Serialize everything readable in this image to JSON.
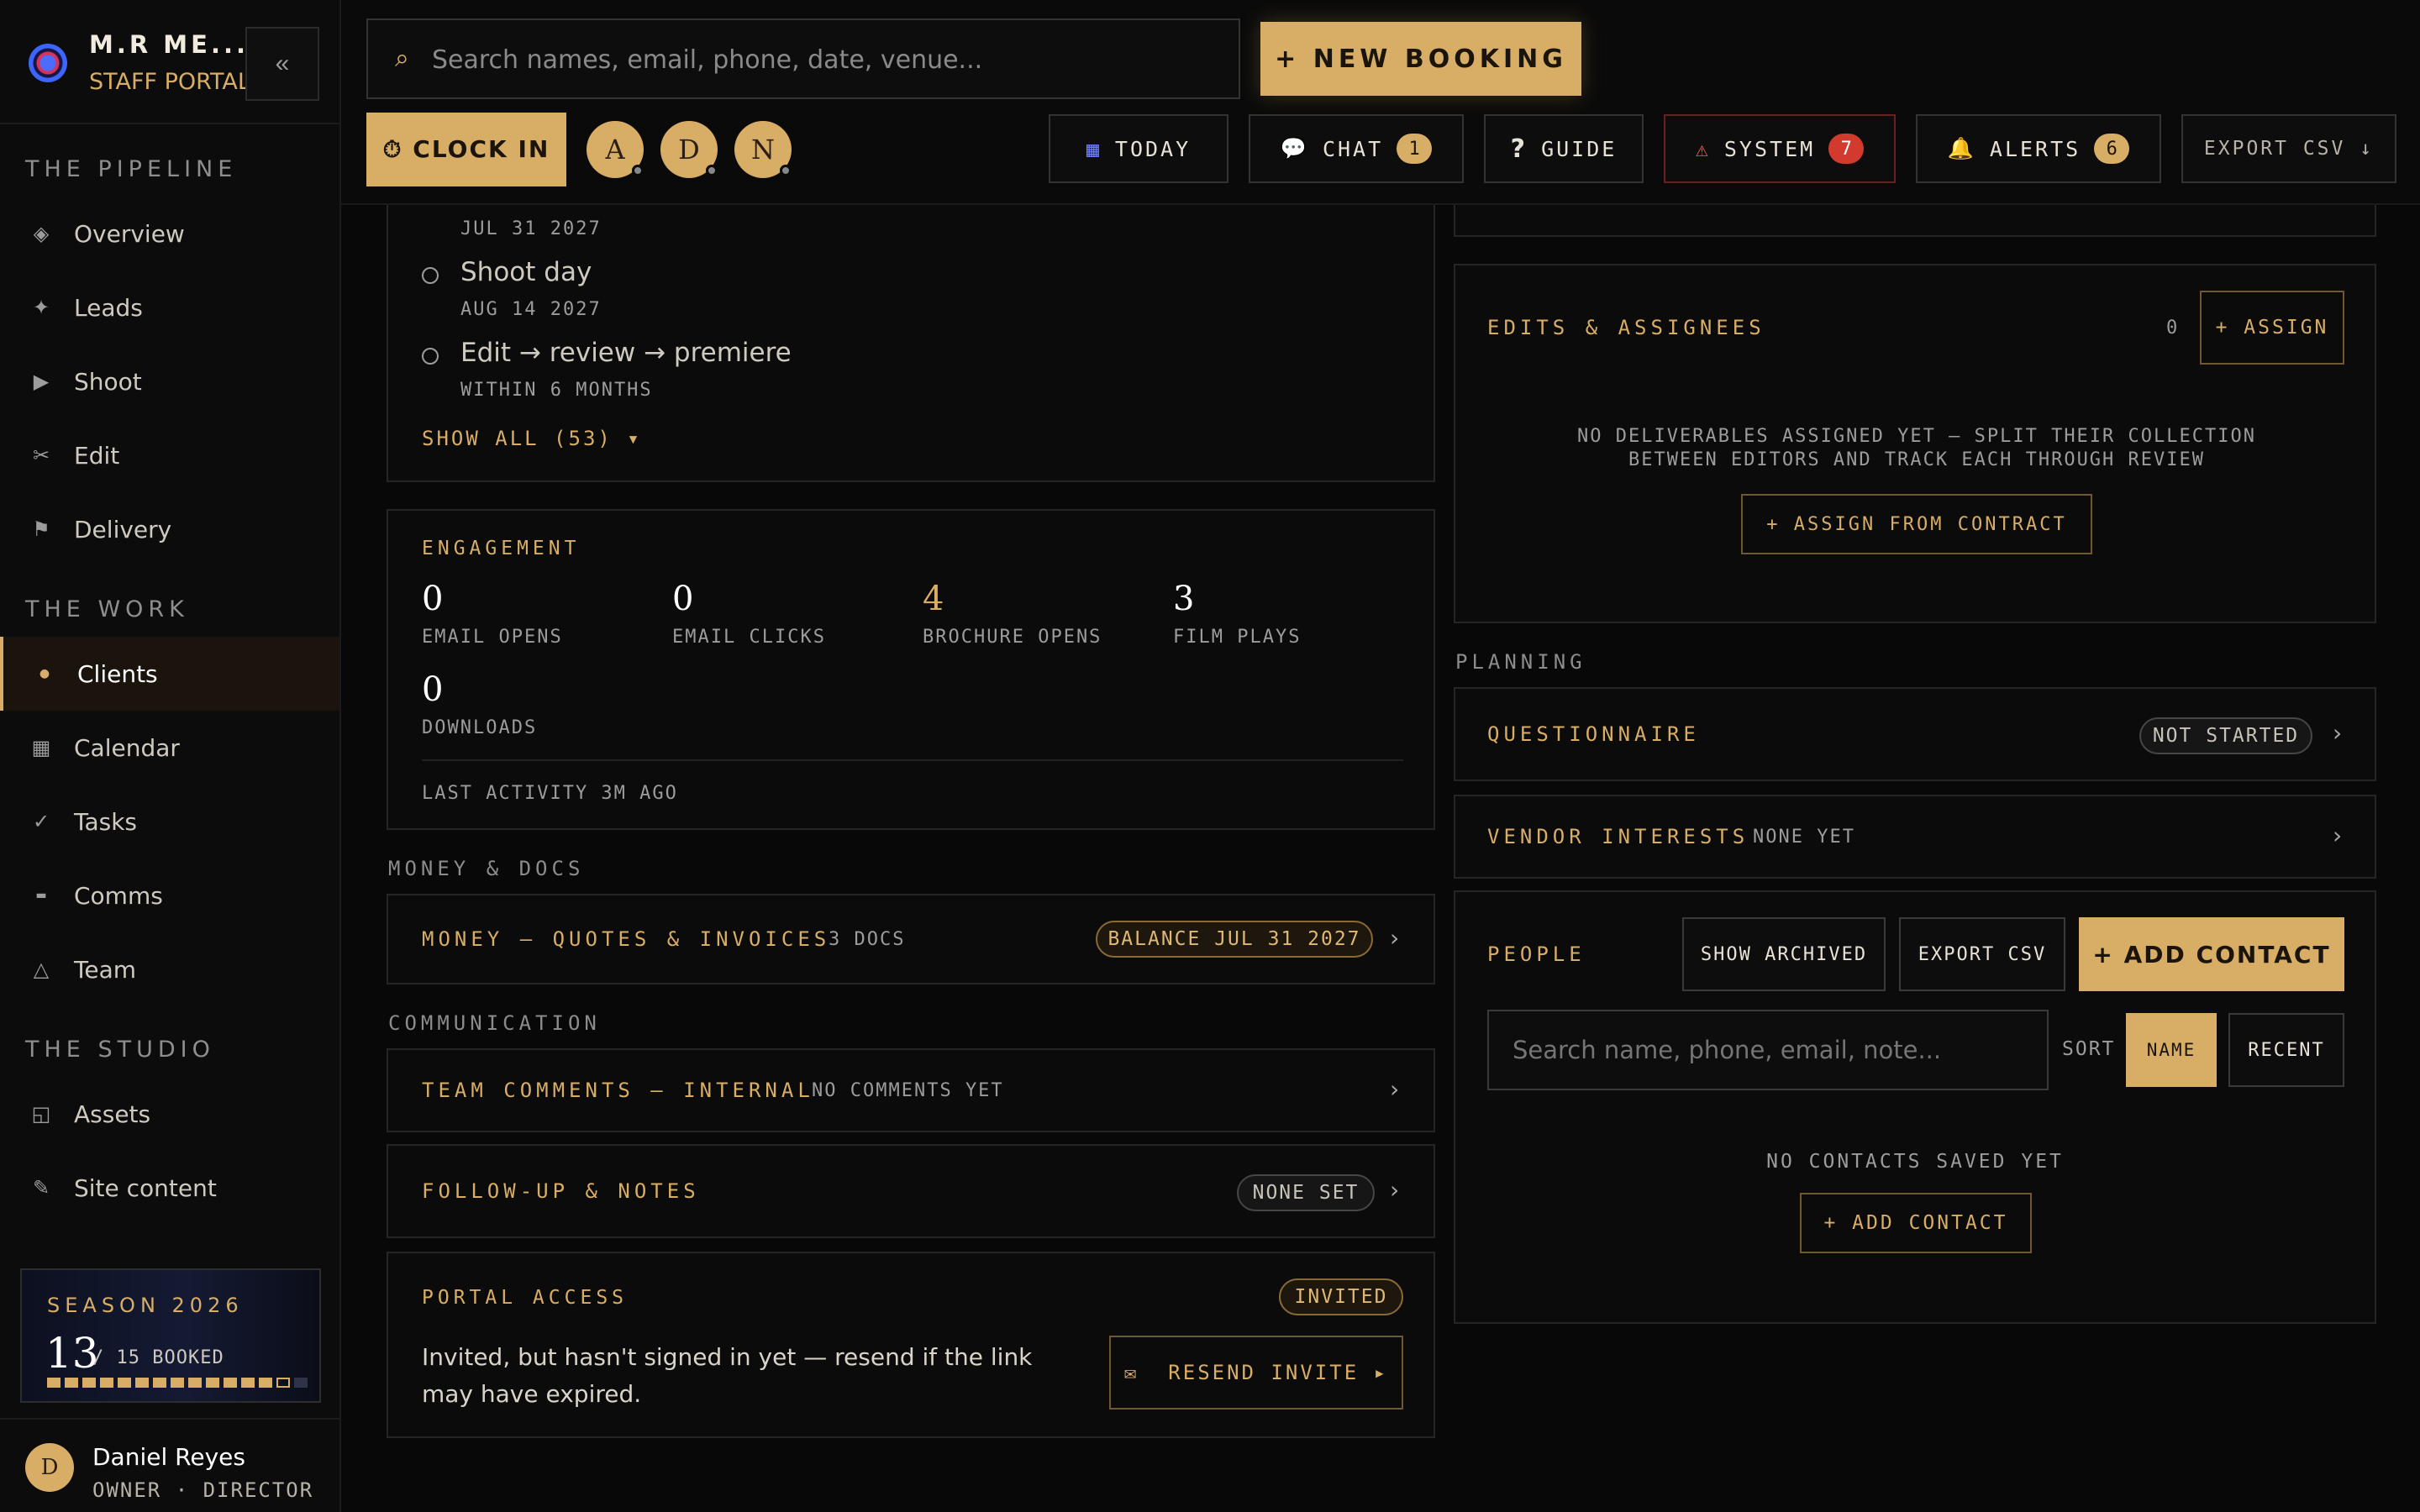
{
  "brand": {
    "name": "M.R ME...",
    "subtitle": "STAFF PORTAL",
    "collapse_glyph": "«"
  },
  "sidebar": {
    "sections": [
      {
        "title": "THE PIPELINE",
        "items": [
          {
            "label": "Overview",
            "icon": "diamond-icon",
            "glyph": "◈"
          },
          {
            "label": "Leads",
            "icon": "sparkle-icon",
            "glyph": "✦"
          },
          {
            "label": "Shoot",
            "icon": "play-icon",
            "glyph": "▶"
          },
          {
            "label": "Edit",
            "icon": "scissors-icon",
            "glyph": "✂"
          },
          {
            "label": "Delivery",
            "icon": "flag-icon",
            "glyph": "⚑"
          }
        ]
      },
      {
        "title": "THE WORK",
        "items": [
          {
            "label": "Clients",
            "icon": "dot-icon",
            "glyph": "●",
            "active": true
          },
          {
            "label": "Calendar",
            "icon": "calendar-grid-icon",
            "glyph": "▦"
          },
          {
            "label": "Tasks",
            "icon": "check-icon",
            "glyph": "✓"
          },
          {
            "label": "Comms",
            "icon": "dash-icon",
            "glyph": "▬"
          },
          {
            "label": "Team",
            "icon": "triangle-icon",
            "glyph": "△"
          }
        ]
      },
      {
        "title": "THE STUDIO",
        "items": [
          {
            "label": "Assets",
            "icon": "assets-icon",
            "glyph": "◱"
          },
          {
            "label": "Site content",
            "icon": "pencil-icon",
            "glyph": "✎"
          }
        ]
      }
    ],
    "season": {
      "title": "SEASON 2026",
      "booked": "13",
      "of_text": "/ 15 BOOKED",
      "booked_count": 13,
      "total": 15
    },
    "user": {
      "initial": "D",
      "name": "Daniel Reyes",
      "role": "OWNER · DIRECTOR"
    }
  },
  "topbar": {
    "search_placeholder": "Search names, email, phone, date, venue...",
    "new_booking": "+ NEW BOOKING",
    "clock_in": "CLOCK IN",
    "presence": [
      "A",
      "D",
      "N"
    ],
    "buttons": {
      "today": "TODAY",
      "chat": "CHAT",
      "chat_count": "1",
      "guide": "GUIDE",
      "system": "SYSTEM",
      "system_count": "7",
      "alerts": "ALERTS",
      "alerts_count": "6",
      "export": "EXPORT CSV ↓"
    }
  },
  "milestones": {
    "top_date": "JUL 31 2027",
    "items": [
      {
        "title": "Shoot day",
        "date": "AUG 14 2027"
      },
      {
        "title": "Edit → review → premiere",
        "date": "WITHIN 6 MONTHS"
      }
    ],
    "show_all": "SHOW ALL (53) ▾"
  },
  "engagement": {
    "title": "ENGAGEMENT",
    "stats": [
      {
        "value": "0",
        "label": "EMAIL OPENS"
      },
      {
        "value": "0",
        "label": "EMAIL CLICKS"
      },
      {
        "value": "4",
        "label": "BROCHURE OPENS"
      },
      {
        "value": "3",
        "label": "FILM PLAYS"
      },
      {
        "value": "0",
        "label": "DOWNLOADS"
      }
    ],
    "last_activity": "LAST ACTIVITY 3M AGO"
  },
  "money_docs": {
    "section": "MONEY & DOCS",
    "title": "MONEY — QUOTES & INVOICES",
    "docs": "3 DOCS",
    "badge": "BALANCE JUL 31 2027"
  },
  "communication": {
    "section": "COMMUNICATION",
    "comments_title": "TEAM COMMENTS — INTERNAL",
    "comments_status": "NO COMMENTS YET",
    "followup_title": "FOLLOW-UP & NOTES",
    "followup_badge": "NONE SET"
  },
  "portal": {
    "title": "PORTAL ACCESS",
    "badge": "INVITED",
    "text": "Invited, but hasn't signed in yet — resend if the link may have expired.",
    "resend": "RESEND INVITE ▸"
  },
  "edits": {
    "title": "EDITS & ASSIGNEES",
    "count": "0",
    "assign": "+ ASSIGN",
    "empty": "NO DELIVERABLES ASSIGNED YET — SPLIT THEIR COLLECTION BETWEEN EDITORS AND TRACK EACH THROUGH REVIEW",
    "assign_from_contract": "+ ASSIGN FROM CONTRACT"
  },
  "planning": {
    "section": "PLANNING",
    "questionnaire": "QUESTIONNAIRE",
    "questionnaire_badge": "NOT STARTED",
    "vendor": "VENDOR INTERESTS",
    "vendor_status": "NONE YET"
  },
  "people": {
    "title": "PEOPLE",
    "show_archived": "SHOW ARCHIVED",
    "export": "EXPORT CSV",
    "add_contact": "+ ADD CONTACT",
    "search_placeholder": "Search name, phone, email, note...",
    "sort_label": "SORT",
    "sort_name": "NAME",
    "sort_recent": "RECENT",
    "empty": "NO CONTACTS SAVED YET",
    "add_contact_small": "+ ADD CONTACT"
  },
  "colors": {
    "accent": "#d8ad66",
    "background": "#080808",
    "danger": "#d23a2e"
  }
}
